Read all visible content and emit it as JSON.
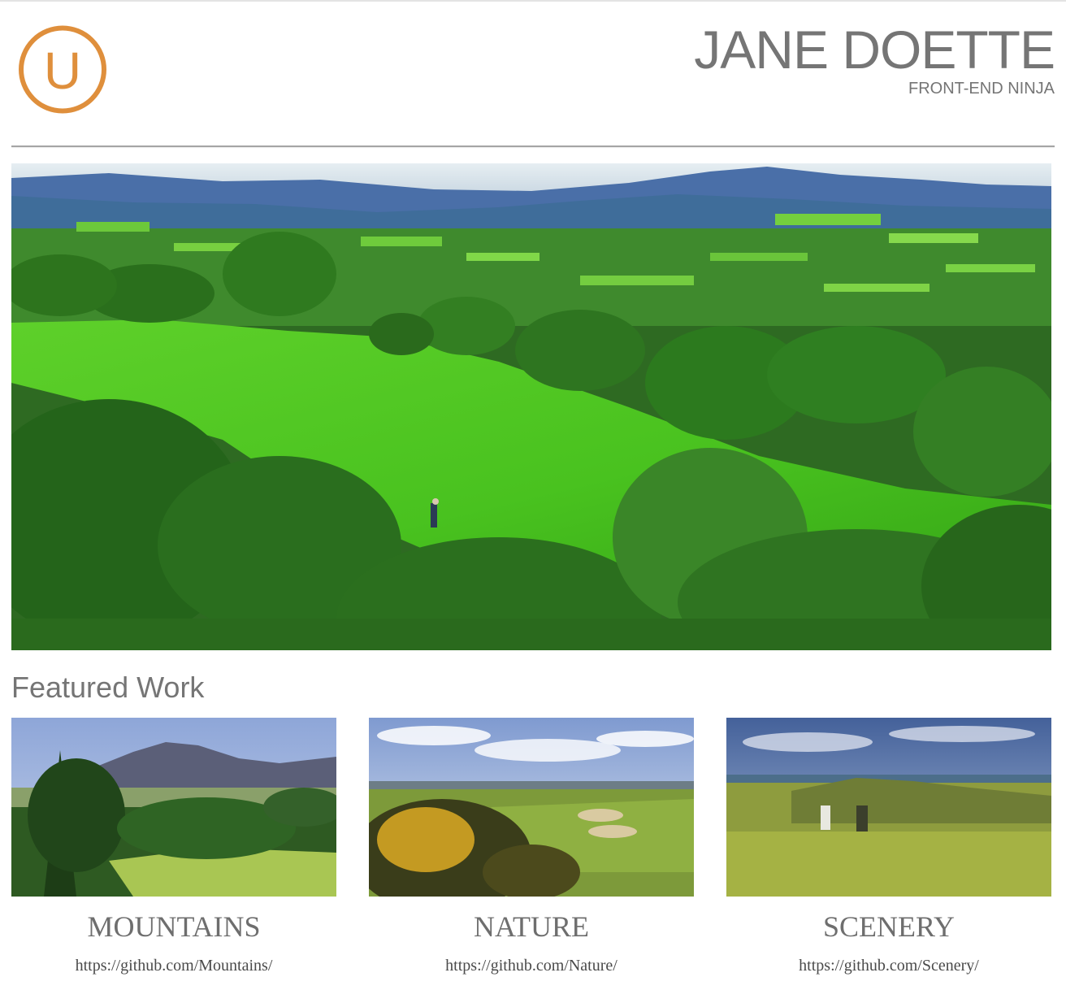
{
  "header": {
    "logo_letter": "U",
    "name": "JANE DOETTE",
    "subtitle": "FRONT-END NINJA"
  },
  "hero": {
    "alt": "golf course landscape"
  },
  "featured": {
    "heading": "Featured Work",
    "projects": [
      {
        "title": "MOUNTAINS",
        "link": "https://github.com/Mountains/"
      },
      {
        "title": "NATURE",
        "link": "https://github.com/Nature/"
      },
      {
        "title": "SCENERY",
        "link": "https://github.com/Scenery/"
      }
    ]
  },
  "colors": {
    "logo_orange": "#df8f3c",
    "text_gray": "#757575",
    "divider_gray": "#a5a5a5"
  }
}
